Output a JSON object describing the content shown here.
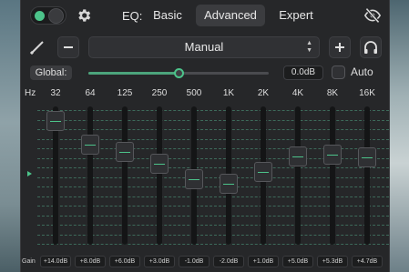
{
  "topbar": {
    "eq_label": "EQ:",
    "tabs": [
      {
        "label": "Basic",
        "active": false
      },
      {
        "label": "Advanced",
        "active": true
      },
      {
        "label": "Expert",
        "active": false
      }
    ],
    "power_on": true,
    "icons": {
      "settings": "gear-icon",
      "visibility": "eye-slash-icon"
    }
  },
  "controls": {
    "preset": "Manual",
    "icons": {
      "pen": "pen-icon",
      "remove": "minus-icon",
      "add": "plus-icon",
      "output": "headphones-icon"
    }
  },
  "global": {
    "label": "Global:",
    "value": "0.0dB",
    "slider_fraction": 0.5,
    "auto_label": "Auto",
    "auto_checked": false
  },
  "bands": {
    "hz_label": "Hz",
    "gain_label": "Gain",
    "range_db": [
      -24,
      24
    ],
    "items": [
      {
        "freq": "32",
        "gain": "+14.0dB",
        "gain_db": 14.0
      },
      {
        "freq": "64",
        "gain": "+8.0dB",
        "gain_db": 8.0
      },
      {
        "freq": "125",
        "gain": "+6.0dB",
        "gain_db": 6.0
      },
      {
        "freq": "250",
        "gain": "+3.0dB",
        "gain_db": 3.0
      },
      {
        "freq": "500",
        "gain": "-1.0dB",
        "gain_db": -1.0
      },
      {
        "freq": "1K",
        "gain": "-2.0dB",
        "gain_db": -2.0
      },
      {
        "freq": "2K",
        "gain": "+1.0dB",
        "gain_db": 1.0
      },
      {
        "freq": "4K",
        "gain": "+5.0dB",
        "gain_db": 5.0
      },
      {
        "freq": "8K",
        "gain": "+5.3dB",
        "gain_db": 5.3
      },
      {
        "freq": "16K",
        "gain": "+4.7dB",
        "gain_db": 4.7
      }
    ]
  },
  "colors": {
    "accent": "#4cc38a",
    "panel": "#262729",
    "grid": "#3d6a5a"
  }
}
